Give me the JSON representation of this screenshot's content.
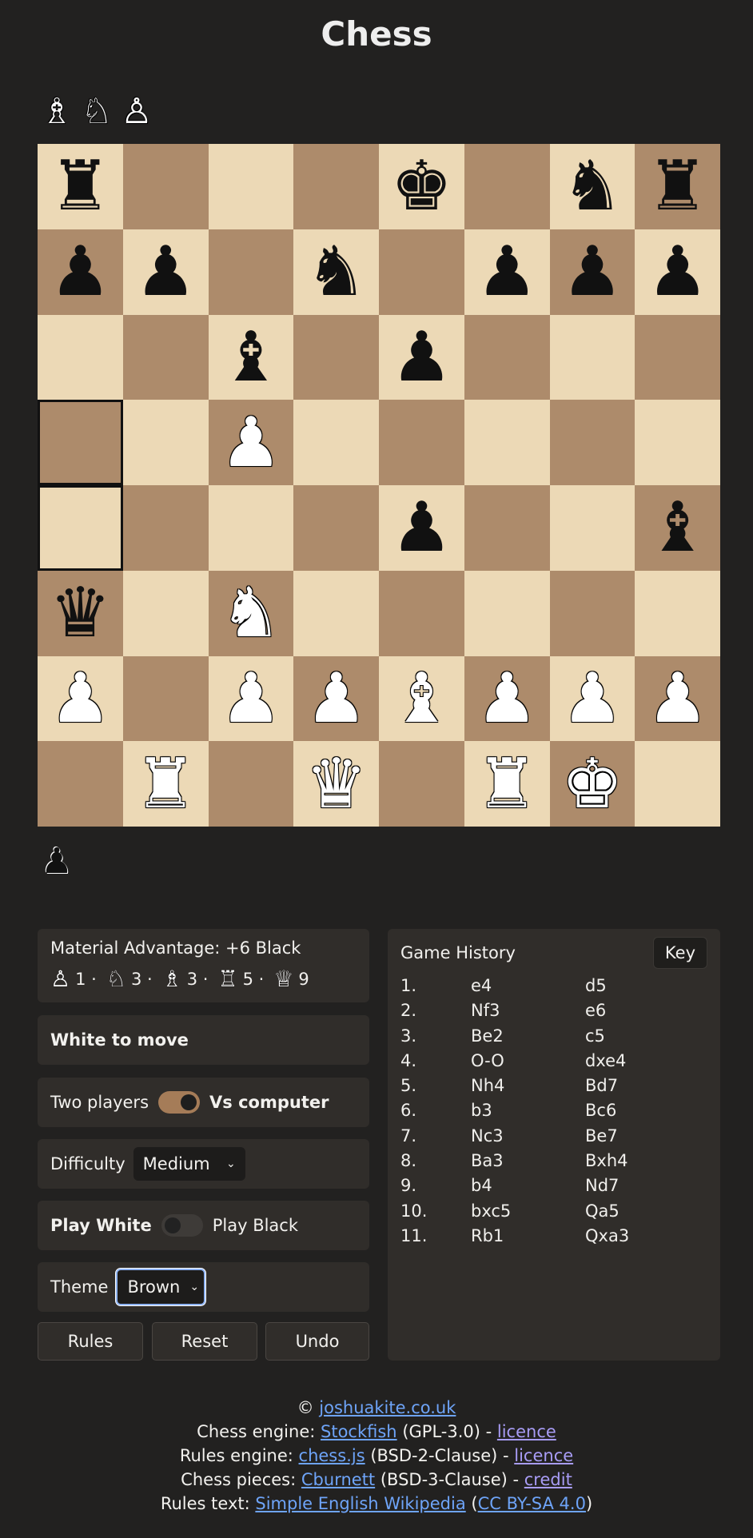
{
  "title": "Chess",
  "captured_top": [
    {
      "glyph": "♗",
      "side": "w",
      "name": "captured-white-bishop-icon"
    },
    {
      "glyph": "♘",
      "side": "w",
      "name": "captured-white-knight-icon"
    },
    {
      "glyph": "♙",
      "side": "w",
      "name": "captured-white-pawn-icon"
    }
  ],
  "captured_bottom": [
    {
      "glyph": "♟",
      "side": "b",
      "name": "captured-black-pawn-icon"
    }
  ],
  "board": {
    "light_color": "#ecd9b6",
    "dark_color": "#ad8b6b",
    "highlighted_squares": [
      "a5",
      "a4"
    ],
    "ranks": [
      [
        "br",
        "",
        "",
        "",
        "bk",
        "",
        "bn",
        "br"
      ],
      [
        "bp",
        "bp",
        "",
        "bn",
        "",
        "bp",
        "bp",
        "bp"
      ],
      [
        "",
        "",
        "bb",
        "",
        "bp",
        "",
        "",
        ""
      ],
      [
        "",
        "",
        "wp",
        "",
        "",
        "",
        "",
        ""
      ],
      [
        "",
        "",
        "",
        "",
        "bp",
        "",
        "",
        "bb"
      ],
      [
        "bq",
        "",
        "wn",
        "",
        "",
        "",
        "",
        ""
      ],
      [
        "wp",
        "",
        "wp",
        "wp",
        "wb",
        "wp",
        "wp",
        "wp"
      ],
      [
        "",
        "wr",
        "",
        "wq",
        "",
        "wr",
        "wk",
        ""
      ]
    ]
  },
  "material": {
    "label": "Material Advantage: +6 Black",
    "values": [
      {
        "icon": "♙",
        "name": "pawn-value-icon",
        "sep": "1 ·"
      },
      {
        "icon": "♘",
        "name": "knight-value-icon",
        "sep": "3 ·"
      },
      {
        "icon": "♗",
        "name": "bishop-value-icon",
        "sep": "3 ·"
      },
      {
        "icon": "♖",
        "name": "rook-value-icon",
        "sep": "5 ·"
      },
      {
        "icon": "♕",
        "name": "queen-value-icon",
        "sep": "9"
      }
    ]
  },
  "status": "White to move",
  "mode": {
    "left": "Two players",
    "right": "Vs computer",
    "vs_computer": true
  },
  "difficulty": {
    "label": "Difficulty",
    "value": "Medium"
  },
  "side": {
    "left": "Play White",
    "right": "Play Black",
    "play_black": false
  },
  "theme": {
    "label": "Theme",
    "value": "Brown"
  },
  "buttons": {
    "rules": "Rules",
    "reset": "Reset",
    "undo": "Undo"
  },
  "history": {
    "title": "Game History",
    "key_label": "Key",
    "moves": [
      {
        "n": "1.",
        "white": "e4",
        "black": "d5"
      },
      {
        "n": "2.",
        "white": "Nf3",
        "black": "e6"
      },
      {
        "n": "3.",
        "white": "Be2",
        "black": "c5"
      },
      {
        "n": "4.",
        "white": "O-O",
        "black": "dxe4"
      },
      {
        "n": "5.",
        "white": "Nh4",
        "black": "Bd7"
      },
      {
        "n": "6.",
        "white": "b3",
        "black": "Bc6"
      },
      {
        "n": "7.",
        "white": "Nc3",
        "black": "Be7"
      },
      {
        "n": "8.",
        "white": "Ba3",
        "black": "Bxh4"
      },
      {
        "n": "9.",
        "white": "b4",
        "black": "Nd7"
      },
      {
        "n": "10.",
        "white": "bxc5",
        "black": "Qa5"
      },
      {
        "n": "11.",
        "white": "Rb1",
        "black": "Qxa3"
      }
    ]
  },
  "footer": {
    "copyright_symbol": "©",
    "site_link": "joshuakite.co.uk",
    "line2": {
      "prefix": "Chess engine:",
      "link": "Stockfish",
      "mid": "(GPL-3.0) -",
      "link2": "licence"
    },
    "line3": {
      "prefix": "Rules engine:",
      "link": "chess.js",
      "mid": "(BSD-2-Clause) -",
      "link2": "licence"
    },
    "line4": {
      "prefix": "Chess pieces:",
      "link": "Cburnett",
      "mid": "(BSD-3-Clause) -",
      "link2": "credit"
    },
    "line5": {
      "prefix": "Rules text:",
      "link": "Simple English Wikipedia",
      "open": "(",
      "link2": "CC BY-SA 4.0",
      "close": ")"
    }
  }
}
